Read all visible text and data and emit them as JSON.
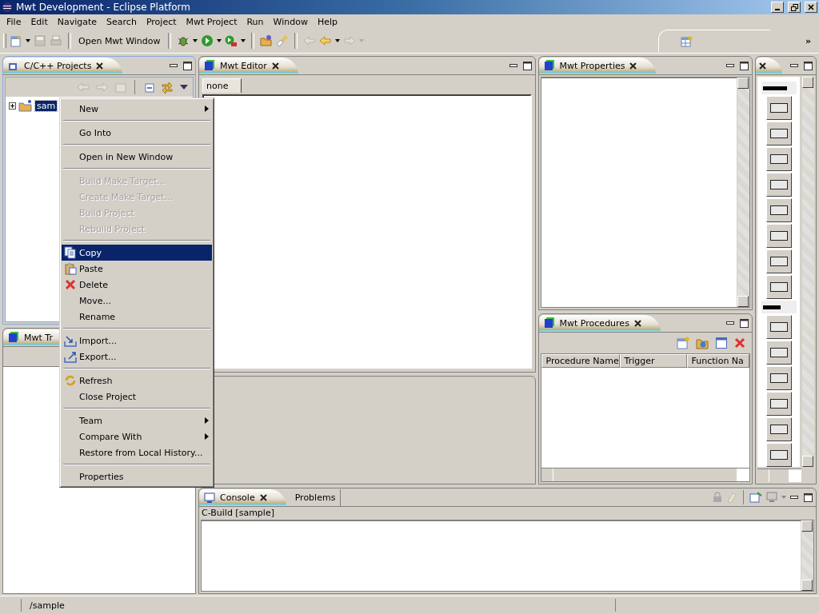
{
  "window": {
    "title": "Mwt Development - Eclipse Platform"
  },
  "menu_bar": [
    "File",
    "Edit",
    "Navigate",
    "Search",
    "Project",
    "Mwt Project",
    "Run",
    "Window",
    "Help"
  ],
  "toolbar": {
    "open_button": "Open Mwt Window",
    "overflow": "»"
  },
  "projects_view": {
    "title": "C/C++ Projects",
    "tree": [
      {
        "label": "sam",
        "expanded": false,
        "selected": true
      }
    ]
  },
  "tree_view": {
    "title": "Mwt Tr"
  },
  "editor": {
    "title": "Mwt Editor",
    "tabs": [
      {
        "label": "none",
        "selected": true
      }
    ]
  },
  "properties_view": {
    "title": "Mwt Properties"
  },
  "procedures_view": {
    "title": "Mwt Procedures",
    "columns": [
      "Procedure Name",
      "Trigger",
      "Function Na"
    ]
  },
  "console_view": {
    "tabs": [
      {
        "label": "Console",
        "selected": true
      },
      {
        "label": "Problems",
        "selected": false
      }
    ],
    "header": "C-Build [sample]"
  },
  "context_menu": {
    "groups": [
      [
        {
          "label": "New",
          "disabled": false,
          "selected": false,
          "submenu": true
        }
      ],
      [
        {
          "label": "Go Into",
          "disabled": false,
          "selected": false,
          "submenu": false
        }
      ],
      [
        {
          "label": "Open in New Window",
          "disabled": false,
          "selected": false,
          "submenu": false
        }
      ],
      [
        {
          "label": "Build Make Target...",
          "disabled": true,
          "selected": false,
          "submenu": false
        },
        {
          "label": "Create Make Target...",
          "disabled": true,
          "selected": false,
          "submenu": false
        },
        {
          "label": "Build Project",
          "disabled": true,
          "selected": false,
          "submenu": false
        },
        {
          "label": "Rebuild Project",
          "disabled": true,
          "selected": false,
          "submenu": false
        }
      ],
      [
        {
          "label": "Copy",
          "disabled": false,
          "selected": true,
          "submenu": false
        },
        {
          "label": "Paste",
          "disabled": false,
          "selected": false,
          "submenu": false
        },
        {
          "label": "Delete",
          "disabled": false,
          "selected": false,
          "submenu": false
        },
        {
          "label": "Move...",
          "disabled": false,
          "selected": false,
          "submenu": false
        },
        {
          "label": "Rename",
          "disabled": false,
          "selected": false,
          "submenu": false
        }
      ],
      [
        {
          "label": "Import...",
          "disabled": false,
          "selected": false,
          "submenu": false
        },
        {
          "label": "Export...",
          "disabled": false,
          "selected": false,
          "submenu": false
        }
      ],
      [
        {
          "label": "Refresh",
          "disabled": false,
          "selected": false,
          "submenu": false
        },
        {
          "label": "Close Project",
          "disabled": false,
          "selected": false,
          "submenu": false
        }
      ],
      [
        {
          "label": "Team",
          "disabled": false,
          "selected": false,
          "submenu": true
        },
        {
          "label": "Compare With",
          "disabled": false,
          "selected": false,
          "submenu": true
        },
        {
          "label": "Restore from Local History...",
          "disabled": false,
          "selected": false,
          "submenu": false
        }
      ],
      [
        {
          "label": "Properties",
          "disabled": false,
          "selected": false,
          "submenu": false
        }
      ]
    ]
  },
  "status_bar": {
    "path": "/sample"
  }
}
